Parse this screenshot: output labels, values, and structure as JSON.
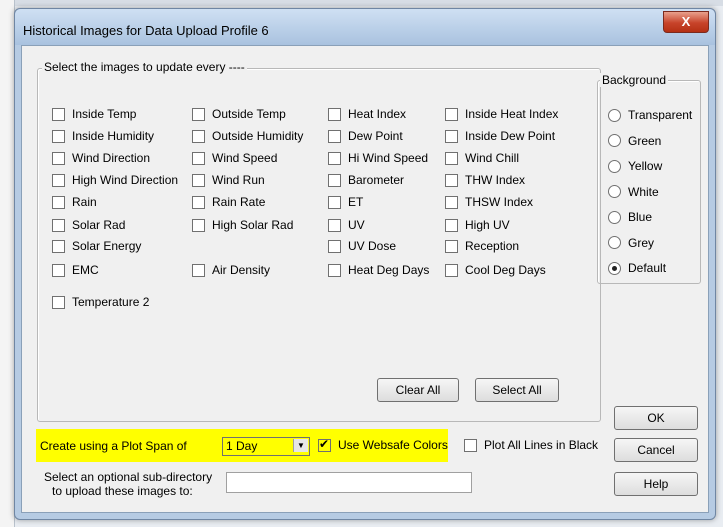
{
  "window": {
    "title": "Historical Images for Data Upload Profile 6",
    "close_label": "X"
  },
  "images_group": {
    "legend": "Select the images to update every ----",
    "columns": [
      [
        "Inside Temp",
        "Inside Humidity",
        "Wind Direction",
        "High Wind Direction",
        "Rain",
        "Solar Rad",
        "Solar Energy",
        "EMC",
        "Temperature 2"
      ],
      [
        "Outside Temp",
        "Outside Humidity",
        "Wind Speed",
        "Wind Run",
        "Rain Rate",
        "High Solar Rad",
        "Air Density"
      ],
      [
        "Heat Index",
        "Dew Point",
        "Hi Wind Speed",
        "Barometer",
        "ET",
        "UV",
        "UV Dose",
        "Heat Deg Days"
      ],
      [
        "Inside Heat Index",
        "Inside Dew Point",
        "Wind Chill",
        "THW Index",
        "THSW Index",
        "High UV",
        "Reception",
        "Cool Deg Days"
      ]
    ],
    "clear_all": "Clear All",
    "select_all": "Select All"
  },
  "background_group": {
    "legend": "Background",
    "options": [
      "Transparent",
      "Green",
      "Yellow",
      "White",
      "Blue",
      "Grey",
      "Default"
    ],
    "selected": "Default"
  },
  "plot_span": {
    "label": "Create using a Plot Span of",
    "value": "1 Day"
  },
  "websafe": {
    "label": "Use Websafe Colors",
    "checked": true
  },
  "plot_black": {
    "label": "Plot All Lines in Black",
    "checked": false
  },
  "subdir": {
    "label_line1": "Select an optional sub-directory",
    "label_line2": "to upload these images to:",
    "value": ""
  },
  "buttons": {
    "ok": "OK",
    "cancel": "Cancel",
    "help": "Help"
  },
  "colors": {
    "highlight": "#ffff00",
    "dialog_frame": "#b6cbe3",
    "close_button": "#c7432a"
  }
}
